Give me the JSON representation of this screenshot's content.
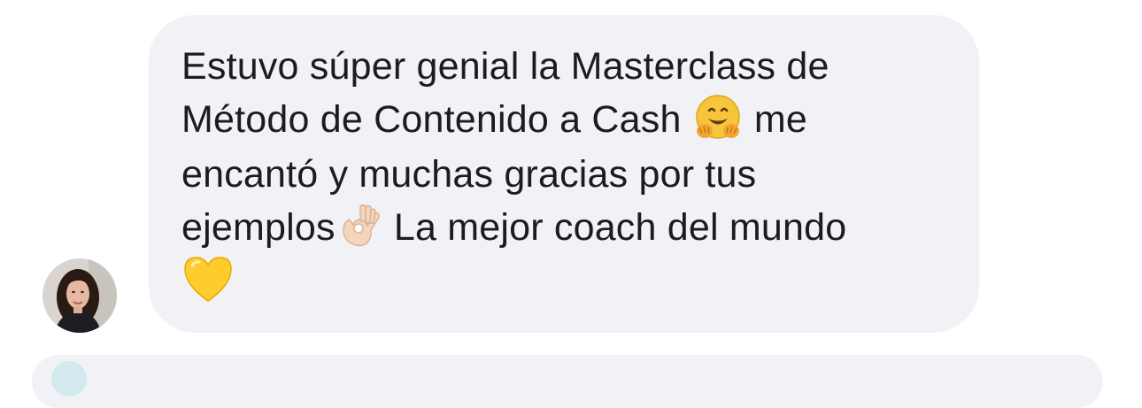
{
  "message": {
    "lines": [
      "Estuvo súper genial la Masterclass  de",
      "Método de Contenido a Cash",
      "me",
      "encantó y muchas gracias por tus",
      "ejemplos",
      " La mejor coach del mundo"
    ]
  },
  "icons": {
    "hugging_face": "hugging-face-emoji",
    "ok_hand": "ok-hand-emoji",
    "yellow_heart": "yellow-heart-emoji",
    "avatar": "user-avatar"
  },
  "colors": {
    "bubble_background": "#f1f2f5",
    "text": "#1c1c1e",
    "page_background": "#ffffff"
  }
}
